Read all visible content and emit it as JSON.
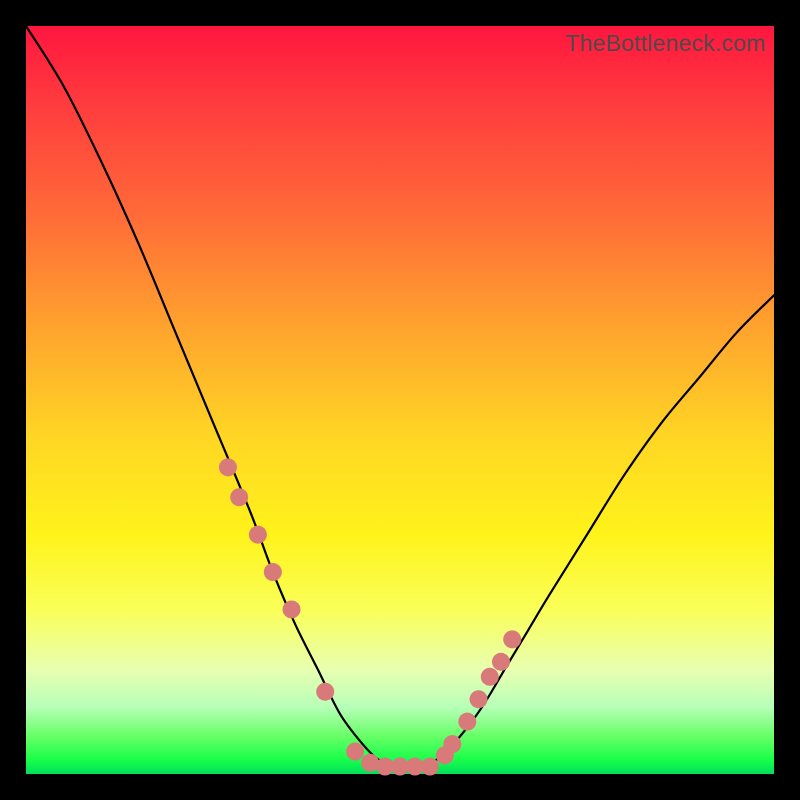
{
  "watermark": "TheBottleneck.com",
  "colors": {
    "frame": "#000000",
    "curve_stroke": "#000000",
    "marker_fill": "#d87a7a",
    "marker_stroke": "#b85a5a",
    "gradient_top": "#ff163f",
    "gradient_bottom": "#00e05a"
  },
  "chart_data": {
    "type": "line",
    "title": "",
    "xlabel": "",
    "ylabel": "",
    "xlim": [
      0,
      100
    ],
    "ylim": [
      0,
      100
    ],
    "series": [
      {
        "name": "bottleneck-curve",
        "x": [
          0,
          5,
          10,
          15,
          20,
          25,
          30,
          33,
          36,
          39,
          42,
          45,
          47,
          49,
          51,
          53,
          55,
          58,
          61,
          64,
          67,
          70,
          75,
          80,
          85,
          90,
          95,
          100
        ],
        "values": [
          100,
          92,
          82,
          71,
          59,
          47,
          35,
          27,
          20,
          14,
          8,
          4,
          2,
          1,
          1,
          1,
          2,
          5,
          9,
          14,
          19,
          24,
          32,
          40,
          47,
          53,
          59,
          64
        ]
      }
    ],
    "markers": {
      "name": "highlighted-points",
      "x": [
        27,
        28.5,
        31,
        33,
        35.5,
        40,
        44,
        46,
        48,
        50,
        52,
        54,
        56,
        57,
        59,
        60.5,
        62,
        63.5,
        65
      ],
      "values": [
        41,
        37,
        32,
        27,
        22,
        11,
        3,
        1.5,
        1,
        1,
        1,
        1,
        2.5,
        4,
        7,
        10,
        13,
        15,
        18
      ]
    }
  }
}
